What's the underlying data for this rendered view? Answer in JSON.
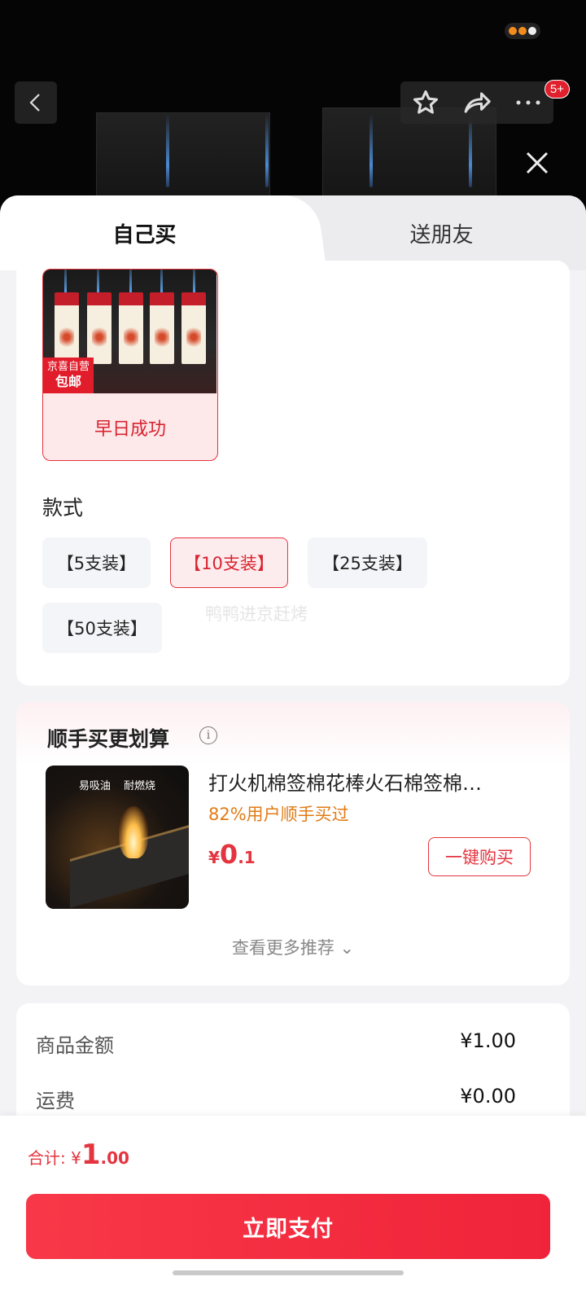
{
  "tabs": {
    "self": "自己买",
    "friend": "送朋友"
  },
  "variant": {
    "tag_top": "京喜自营",
    "tag_bottom": "包邮",
    "label": "早日成功"
  },
  "style_section": {
    "title": "款式",
    "options": [
      "【5支装】",
      "【10支装】",
      "【25支装】",
      "【50支装】"
    ],
    "selected_index": 1
  },
  "watermark": "鸭鸭进京赶烤",
  "buy_together": {
    "title": "顺手买更划算",
    "info_icon": "i",
    "product_image_caption": "易吸油 耐燃烧",
    "product_name": "打火机棉签棉花棒火石棉签棉…",
    "buy_rate": "82%用户顺手买过",
    "price_currency": "¥",
    "price_int": "0",
    "price_dec": ".1",
    "buy_button": "一键购买",
    "more": "查看更多推荐 ⌄"
  },
  "costs": [
    {
      "label": "商品金额",
      "value": "¥1.00"
    },
    {
      "label": "运费",
      "value": "¥0.00"
    }
  ],
  "total": {
    "label": "合计: ¥",
    "int": "1",
    "dec": ".00"
  },
  "pay_button": "立即支付",
  "nav": {
    "badge": "5+"
  },
  "colors": {
    "accent": "#e4343f",
    "orange": "#e17b17"
  }
}
